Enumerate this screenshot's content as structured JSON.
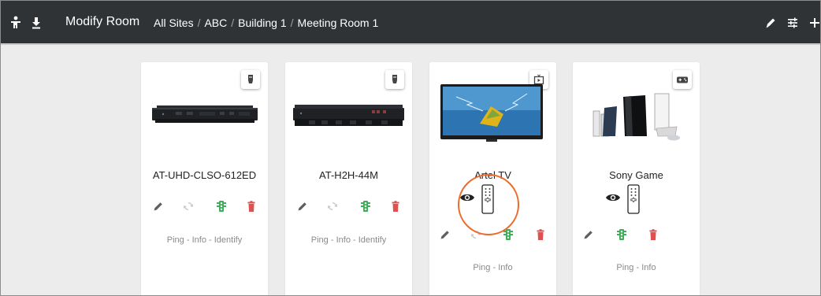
{
  "header": {
    "title": "Modify Room",
    "breadcrumb": [
      "All Sites",
      "ABC",
      "Building 1",
      "Meeting Room 1"
    ],
    "breadcrumb_separator": "/"
  },
  "cards": [
    {
      "name": "AT-UHD-CLSO-612ED",
      "type_icon": "hdmi-plug-icon",
      "links": [
        "Ping",
        "Info",
        "Identify"
      ]
    },
    {
      "name": "AT-H2H-44M",
      "type_icon": "hdmi-plug-icon",
      "links": [
        "Ping",
        "Info",
        "Identify"
      ]
    },
    {
      "name": "Artel TV",
      "type_icon": "tv-icon",
      "links": [
        "Ping",
        "Info"
      ]
    },
    {
      "name": "Sony Game",
      "type_icon": "gamepad-icon",
      "links": [
        "Ping",
        "Info"
      ]
    }
  ],
  "link_separator": " - ",
  "colors": {
    "topbar": "#2f3335",
    "edit_icon": "#5f5f5f",
    "refresh_icon": "#c9c9c9",
    "traffic_icon": "#3fae59",
    "delete_icon": "#e05050",
    "highlight": "#ee6a2a"
  }
}
